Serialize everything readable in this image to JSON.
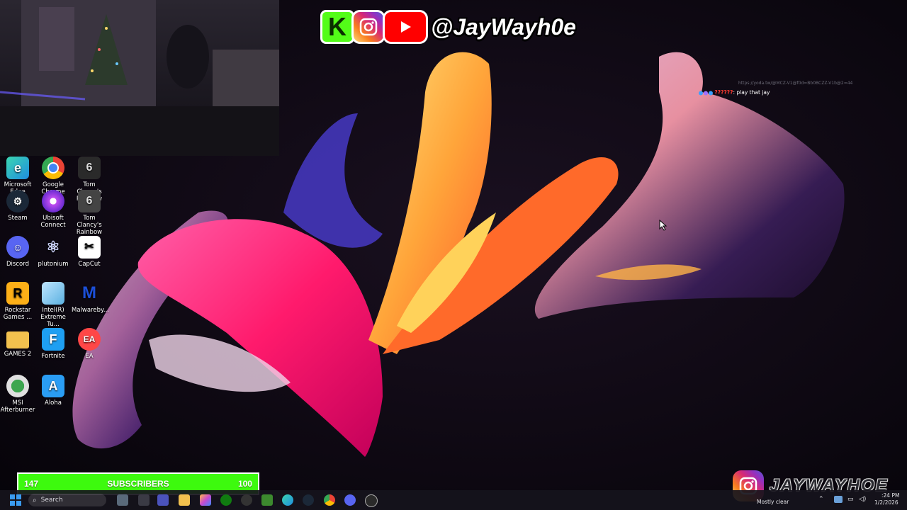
{
  "social_banner": {
    "kick_letter": "K",
    "handle": "@JayWayh0e"
  },
  "chat": {
    "url": "https://yoda.tw/@MCZ-V1@f0d=Bb0BCZZ-V1b@2=44",
    "username": "??????",
    "message": ": play that jay"
  },
  "desktop_icons": [
    {
      "label": "Microsoft Edge",
      "icon": "edge-icon",
      "color": "#1f8de0"
    },
    {
      "label": "Google Chrome",
      "icon": "chrome-icon",
      "color": "#e9b01a"
    },
    {
      "label": "Tom Clancy's Rainbow Si...",
      "icon": "rainbow-six-icon",
      "color": "#2a2a2a"
    },
    {
      "label": "Steam",
      "icon": "steam-icon",
      "color": "#1b2838"
    },
    {
      "label": "Ubisoft Connect",
      "icon": "ubisoft-icon",
      "color": "#c04cf0"
    },
    {
      "label": "Tom Clancy's Rainbow Si...",
      "icon": "rainbow-six-icon",
      "color": "#444"
    },
    {
      "label": "Discord",
      "icon": "discord-icon",
      "color": "#5865f2"
    },
    {
      "label": "plutonium",
      "icon": "atom-icon",
      "color": "#333"
    },
    {
      "label": "CapCut",
      "icon": "capcut-icon",
      "color": "#fff"
    },
    {
      "label": "Rockstar Games ...",
      "icon": "rockstar-icon",
      "color": "#fcaf17"
    },
    {
      "label": "Intel(R) Extreme Tu...",
      "icon": "intel-xtu-icon",
      "color": "#5ab0e0"
    },
    {
      "label": "Malwareby...",
      "icon": "malwarebytes-icon",
      "color": "#1c4fd8"
    },
    {
      "label": "GAMES 2",
      "icon": "folder-icon",
      "color": "#f2c14e"
    },
    {
      "label": "Fortnite",
      "icon": "fortnite-icon",
      "color": "#1e9ff2"
    },
    {
      "label": "EA",
      "icon": "ea-icon",
      "color": "#ff4747"
    },
    {
      "label": "MSI Afterburner",
      "icon": "msi-afterburner-icon",
      "color": "#3da64f"
    },
    {
      "label": "Aloha",
      "icon": "aloha-icon",
      "color": "#2a9df4"
    }
  ],
  "subscriber_bar": {
    "current": "147",
    "label": "SUBSCRIBERS",
    "goal": "100",
    "color": "#3dfa0e"
  },
  "instagram_overlay": {
    "name": "JAYWAYHOE"
  },
  "taskbar": {
    "search_label": "Search",
    "apps": [
      "widgets-icon",
      "file-explorer-icon",
      "teams-icon",
      "folder-icon",
      "copilot-icon",
      "xbox-icon",
      "xbox-app-icon",
      "minecraft-icon",
      "edge-icon",
      "steam-icon",
      "chrome-icon",
      "discord-icon",
      "obs-icon"
    ],
    "weather": "Mostly clear",
    "time": ":24 PM",
    "date": "1/2/2026"
  }
}
